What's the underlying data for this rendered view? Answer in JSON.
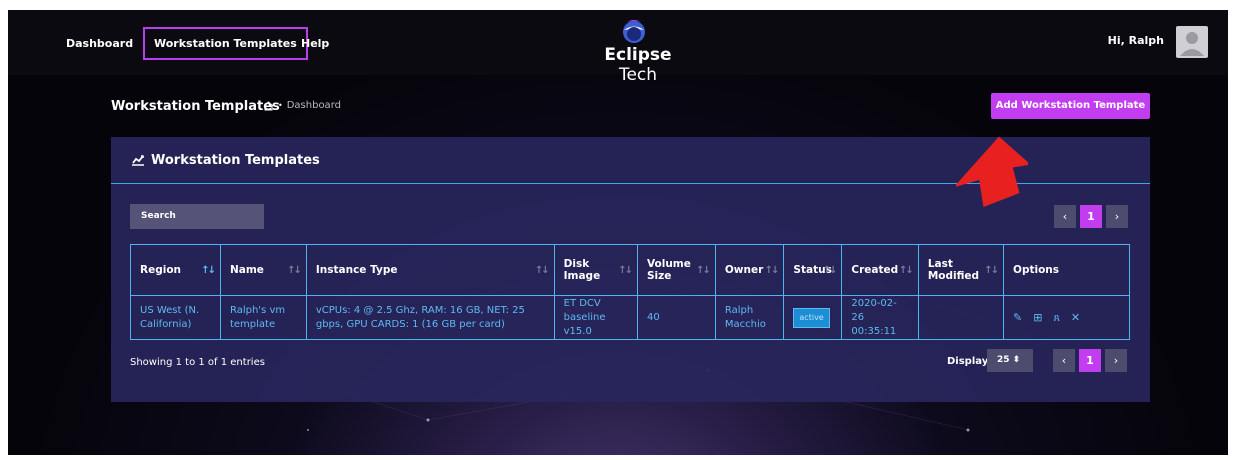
{
  "nav": {
    "dashboard": "Dashboard",
    "workstation_templates": "Workstation Templates",
    "help": "Help"
  },
  "brand": {
    "bold": "Eclipse",
    "light": " Tech"
  },
  "user": {
    "greeting": "Hi, Ralph"
  },
  "page": {
    "title": "Workstation Templates",
    "breadcrumb": "Dashboard",
    "add_button": "Add Workstation Template"
  },
  "panel": {
    "title": "Workstation Templates",
    "search_placeholder": "Search"
  },
  "table": {
    "columns": [
      "Region",
      "Name",
      "Instance Type",
      "Disk Image",
      "Volume Size",
      "Owner",
      "Status",
      "Created",
      "Last Modified",
      "Options"
    ],
    "rows": [
      {
        "region": "US West (N. California)",
        "name": "Ralph's vm template",
        "instance_type": "vCPUs: 4 @ 2.5 Ghz, RAM: 16 GB, NET: 25 gbps, GPU CARDS: 1 (16 GB per card)",
        "disk_image": "ET DCV baseline v15.0",
        "volume_size": "40",
        "owner": "Ralph Macchio",
        "status": "active",
        "created": "2020-02-26 00:35:11",
        "last_modified": ""
      }
    ]
  },
  "pagination": {
    "current_page": "1",
    "display_label": "Display",
    "page_size": "25",
    "showing": "Showing 1 to 1 of 1 entries"
  },
  "colors": {
    "accent": "#c33df0",
    "table_border": "#4fb4f0",
    "panel_bg": "#28265c",
    "annotation_arrow": "#e8201f"
  }
}
